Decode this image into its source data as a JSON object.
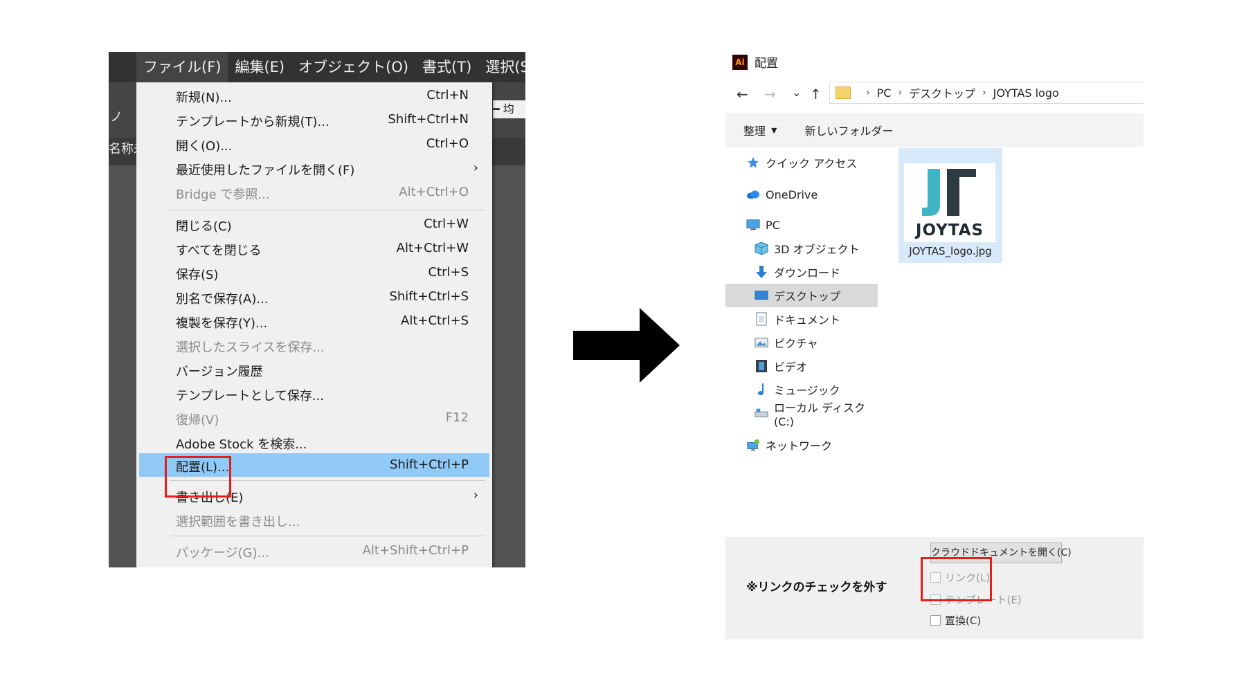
{
  "menubar": {
    "items": [
      "ファイル(F)",
      "編集(E)",
      "オブジェクト(O)",
      "書式(T)",
      "選択(S"
    ]
  },
  "ai_fragments": {
    "left_mark": "ノ",
    "left_label": "名称未",
    "right_stub": "━ 均"
  },
  "file_menu": {
    "new": {
      "label": "新規(N)...",
      "shortcut": "Ctrl+N"
    },
    "new_from_template": {
      "label": "テンプレートから新規(T)...",
      "shortcut": "Shift+Ctrl+N"
    },
    "open": {
      "label": "開く(O)...",
      "shortcut": "Ctrl+O"
    },
    "recent": {
      "label": "最近使用したファイルを開く(F)"
    },
    "bridge": {
      "label": "Bridge で参照...",
      "shortcut": "Alt+Ctrl+O"
    },
    "close": {
      "label": "閉じる(C)",
      "shortcut": "Ctrl+W"
    },
    "close_all": {
      "label": "すべてを閉じる",
      "shortcut": "Alt+Ctrl+W"
    },
    "save": {
      "label": "保存(S)",
      "shortcut": "Ctrl+S"
    },
    "save_as": {
      "label": "別名で保存(A)...",
      "shortcut": "Shift+Ctrl+S"
    },
    "save_copy": {
      "label": "複製を保存(Y)...",
      "shortcut": "Alt+Ctrl+S"
    },
    "save_slices": {
      "label": "選択したスライスを保存..."
    },
    "version_history": {
      "label": "バージョン履歴"
    },
    "save_template": {
      "label": "テンプレートとして保存..."
    },
    "revert": {
      "label": "復帰(V)",
      "shortcut": "F12"
    },
    "adobe_stock": {
      "label": "Adobe Stock を検索..."
    },
    "place": {
      "label": "配置(L)...",
      "shortcut": "Shift+Ctrl+P"
    },
    "export": {
      "label": "書き出し(E)"
    },
    "export_selection": {
      "label": "選択範囲を書き出し..."
    },
    "package": {
      "label": "パッケージ(G)...",
      "shortcut": "Alt+Shift+Ctrl+P"
    },
    "chevron": "›"
  },
  "dialog": {
    "app_badge": "Ai",
    "title": "配置",
    "nav": {
      "back": "←",
      "forward": "→",
      "recent": "⌄",
      "up": "↑"
    },
    "breadcrumbs": [
      "PC",
      "デスクトップ",
      "JOYTAS logo"
    ],
    "crumb_sep": "›",
    "toolbar": {
      "organize": "整理",
      "organize_caret": "▼",
      "new_folder": "新しいフォルダー"
    },
    "nav_items": {
      "quick_access": "クイック アクセス",
      "onedrive": "OneDrive",
      "pc": "PC",
      "objects3d": "3D オブジェクト",
      "downloads": "ダウンロード",
      "desktop": "デスクトップ",
      "documents": "ドキュメント",
      "pictures": "ピクチャ",
      "videos": "ビデオ",
      "music": "ミュージック",
      "local_disk": "ローカル ディスク (C:)",
      "network": "ネットワーク"
    },
    "file": {
      "name": "JOYTAS_logo.jpg",
      "logo_text": "JOYTAS"
    },
    "bottom": {
      "note": "※リンクのチェックを外す",
      "cloud_button": "クラウドドキュメントを開く(C)",
      "link": "リンク(L)",
      "template": "テンプレート(E)",
      "replace": "置換(C)"
    }
  },
  "colors": {
    "menu_highlight": "#91c9f7",
    "annotation_red": "#e41d1d",
    "logo_teal": "#3fb5c5",
    "logo_dark": "#2c3a44"
  }
}
